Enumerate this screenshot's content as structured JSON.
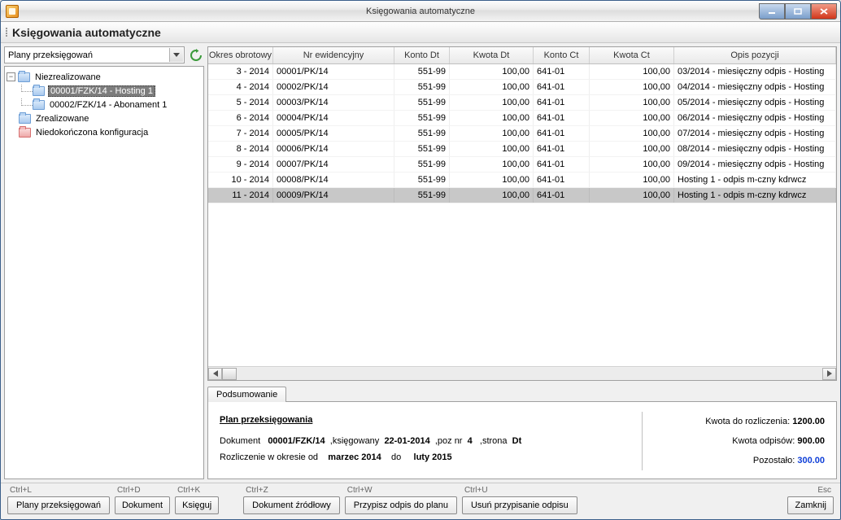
{
  "window": {
    "title": "Księgowania automatyczne"
  },
  "header": {
    "title": "Księgowania automatyczne"
  },
  "sidebar": {
    "combo": "Plany przeksięgowań",
    "tree": {
      "root": "Niezrealizowane",
      "child1": "00001/FZK/14 - Hosting 1",
      "child2": "00002/FZK/14 - Abonament 1",
      "node2": "Zrealizowane",
      "node3": "Niedokończona konfiguracja"
    }
  },
  "grid": {
    "headers": [
      "Okres obrotowy",
      "Nr ewidencyjny",
      "Konto Dt",
      "Kwota Dt",
      "Konto Ct",
      "Kwota Ct",
      "Opis pozycji"
    ],
    "rows": [
      {
        "okres": "3 - 2014",
        "nr": "00001/PK/14",
        "kdt": "551-99",
        "kwdt": "100,00",
        "kct": "641-01",
        "kwct": "100,00",
        "opis": "03/2014 - miesięczny odpis - Hosting"
      },
      {
        "okres": "4 - 2014",
        "nr": "00002/PK/14",
        "kdt": "551-99",
        "kwdt": "100,00",
        "kct": "641-01",
        "kwct": "100,00",
        "opis": "04/2014 - miesięczny odpis - Hosting"
      },
      {
        "okres": "5 - 2014",
        "nr": "00003/PK/14",
        "kdt": "551-99",
        "kwdt": "100,00",
        "kct": "641-01",
        "kwct": "100,00",
        "opis": "05/2014 - miesięczny odpis - Hosting"
      },
      {
        "okres": "6 - 2014",
        "nr": "00004/PK/14",
        "kdt": "551-99",
        "kwdt": "100,00",
        "kct": "641-01",
        "kwct": "100,00",
        "opis": "06/2014 - miesięczny odpis - Hosting"
      },
      {
        "okres": "7 - 2014",
        "nr": "00005/PK/14",
        "kdt": "551-99",
        "kwdt": "100,00",
        "kct": "641-01",
        "kwct": "100,00",
        "opis": "07/2014 - miesięczny odpis - Hosting"
      },
      {
        "okres": "8 - 2014",
        "nr": "00006/PK/14",
        "kdt": "551-99",
        "kwdt": "100,00",
        "kct": "641-01",
        "kwct": "100,00",
        "opis": "08/2014 - miesięczny odpis - Hosting"
      },
      {
        "okres": "9 - 2014",
        "nr": "00007/PK/14",
        "kdt": "551-99",
        "kwdt": "100,00",
        "kct": "641-01",
        "kwct": "100,00",
        "opis": "09/2014 - miesięczny odpis - Hosting"
      },
      {
        "okres": "10 - 2014",
        "nr": "00008/PK/14",
        "kdt": "551-99",
        "kwdt": "100,00",
        "kct": "641-01",
        "kwct": "100,00",
        "opis": "Hosting 1 - odpis m-czny kdrwcz"
      },
      {
        "okres": "11 - 2014",
        "nr": "00009/PK/14",
        "kdt": "551-99",
        "kwdt": "100,00",
        "kct": "641-01",
        "kwct": "100,00",
        "opis": "Hosting 1 - odpis m-czny kdrwcz"
      }
    ],
    "selected_index": 8
  },
  "summary": {
    "tab": "Podsumowanie",
    "plan_label": "Plan przeksięgowania",
    "doc_label": "Dokument",
    "doc_value": "00001/FZK/14",
    "ksieq_label": ",księgowany",
    "ksieq_value": "22-01-2014",
    "poz_label": ",poz nr",
    "poz_value": "4",
    "strona_label": ",strona",
    "strona_value": "Dt",
    "rozl_label": "Rozliczenie w okresie od",
    "rozl_from": "marzec  2014",
    "rozl_to_label": "do",
    "rozl_to": "luty  2015",
    "kwota_rozl_label": "Kwota do rozliczenia:",
    "kwota_rozl_value": "1200.00",
    "kwota_odp_label": "Kwota odpisów:",
    "kwota_odp_value": "900.00",
    "pozostalo_label": "Pozostało:",
    "pozostalo_value": "300.00"
  },
  "buttons": {
    "b1": {
      "short": "Ctrl+L",
      "label": "Plany przeksięgowań"
    },
    "b2": {
      "short": "Ctrl+D",
      "label": "Dokument"
    },
    "b3": {
      "short": "Ctrl+K",
      "label": "Księguj"
    },
    "b4": {
      "short": "Ctrl+Z",
      "label": "Dokument źródłowy"
    },
    "b5": {
      "short": "Ctrl+W",
      "label": "Przypisz odpis do planu"
    },
    "b6": {
      "short": "Ctrl+U",
      "label": "Usuń przypisanie odpisu"
    },
    "close": {
      "short": "Esc",
      "label": "Zamknij"
    }
  }
}
